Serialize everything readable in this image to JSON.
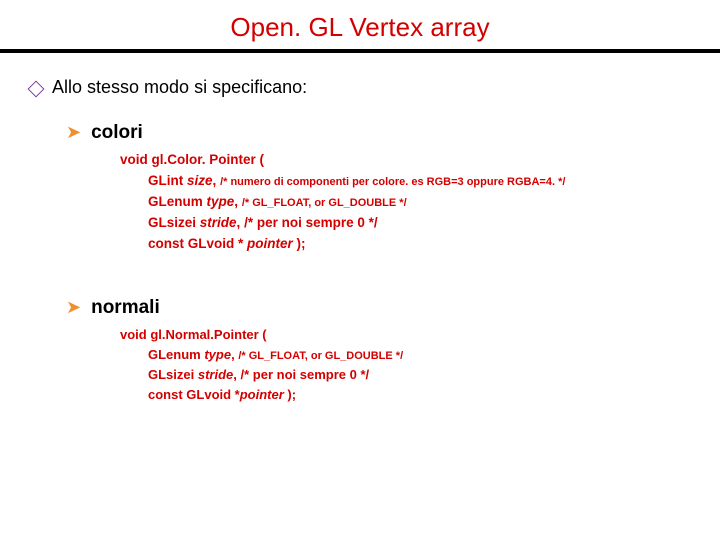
{
  "title": "Open. GL Vertex array",
  "intro": "Allo stesso modo si specificano:",
  "sections": [
    {
      "heading": "colori",
      "sig_open": "void gl.Color. Pointer (",
      "params": [
        {
          "type": "GLint ",
          "name": "size",
          "tail": ",",
          "comment": "/* numero di componenti per colore. es RGB=3 oppure RGBA=4. */",
          "comment_small": true
        },
        {
          "type": "GLenum ",
          "name": "type",
          "tail": ",",
          "comment": "/* GL_FLOAT, or GL_DOUBLE */",
          "comment_small": true
        },
        {
          "type": "GLsizei ",
          "name": "stride",
          "tail": ",",
          "comment": "/* per noi sempre 0 */",
          "comment_small": false
        },
        {
          "type": "const GLvoid * ",
          "name": "pointer",
          "tail": " );",
          "comment": "",
          "comment_small": false
        }
      ]
    },
    {
      "heading": "normali",
      "sig_open": "void gl.Normal.Pointer (",
      "params": [
        {
          "type": "GLenum ",
          "name": "type",
          "tail": ",",
          "comment": "/* GL_FLOAT, or GL_DOUBLE */",
          "comment_small": true
        },
        {
          "type": "GLsizei ",
          "name": "stride",
          "tail": ",",
          "comment": "/* per noi sempre 0 */",
          "comment_small": false
        },
        {
          "type": "const GLvoid *",
          "name": "pointer",
          "tail": " );",
          "comment": "",
          "comment_small": false
        }
      ]
    }
  ]
}
